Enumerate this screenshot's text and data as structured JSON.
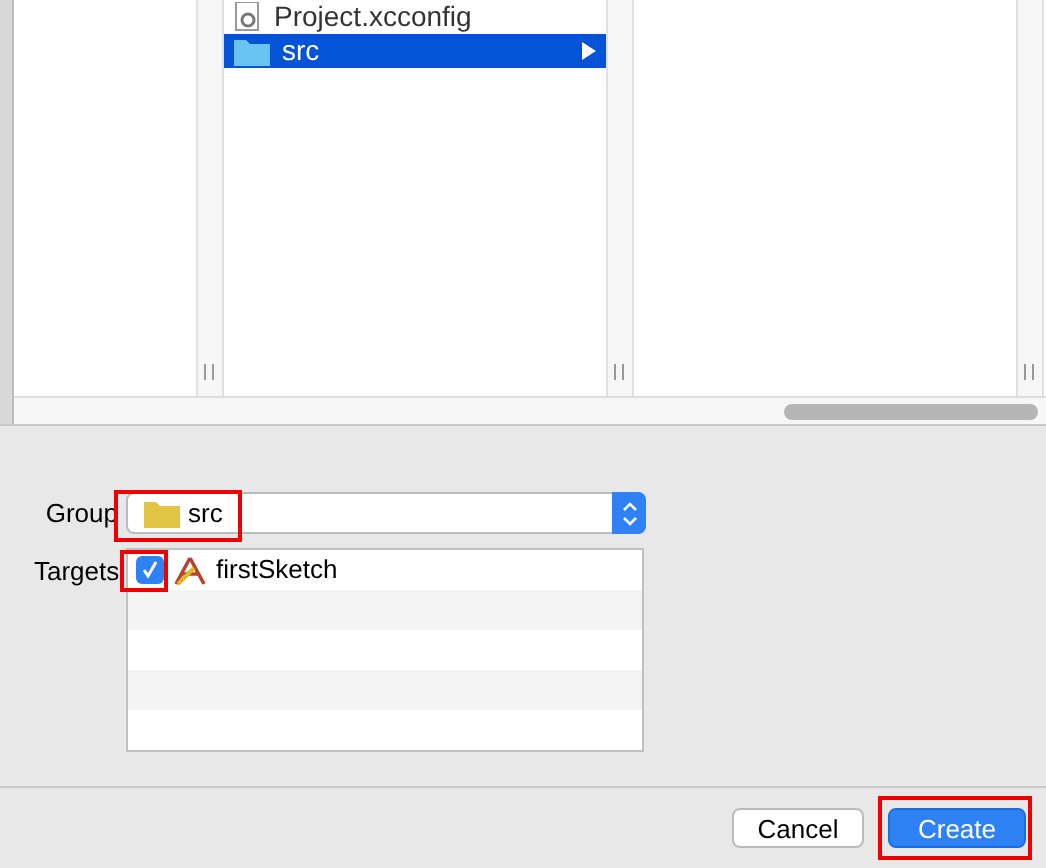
{
  "browser": {
    "items": [
      {
        "label": "Project.xcconfig",
        "kind": "config",
        "selected": false,
        "has_children": false
      },
      {
        "label": "src",
        "kind": "folder",
        "selected": true,
        "has_children": true
      }
    ]
  },
  "group": {
    "label": "Group",
    "value": "src",
    "highlighted": true
  },
  "targets": {
    "label": "Targets",
    "rows": [
      {
        "name": "firstSketch",
        "checked": true,
        "highlighted": true
      }
    ]
  },
  "buttons": [
    {
      "label": "Cancel",
      "kind": "default",
      "highlighted": false
    },
    {
      "label": "Create",
      "kind": "primary",
      "highlighted": true
    }
  ]
}
